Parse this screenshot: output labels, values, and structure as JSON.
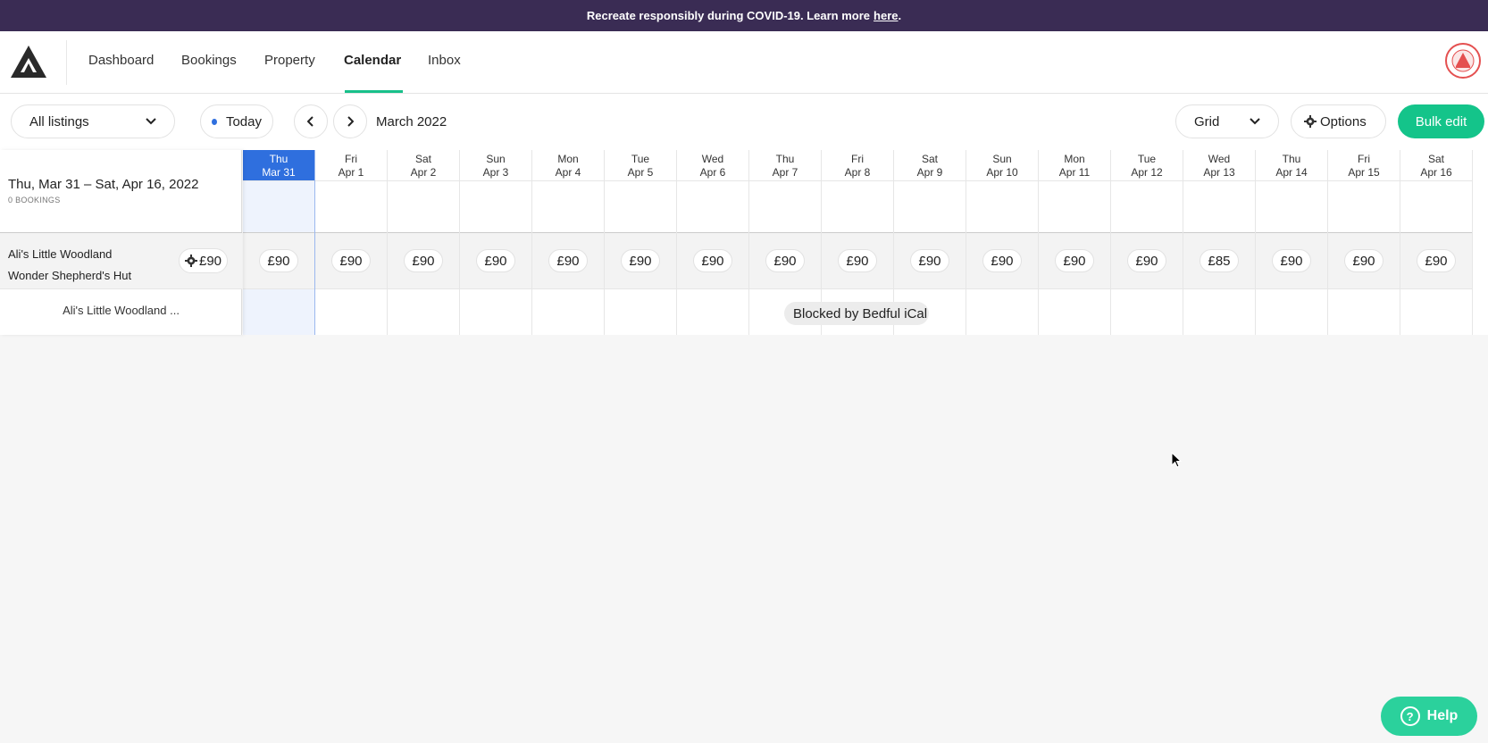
{
  "banner": {
    "text": "Recreate responsibly during COVID-19. Learn more",
    "link": "here",
    "suffix": "."
  },
  "nav": {
    "items": [
      {
        "label": "Dashboard"
      },
      {
        "label": "Bookings"
      },
      {
        "label": "Property"
      },
      {
        "label": "Calendar"
      },
      {
        "label": "Inbox"
      }
    ],
    "active": "Calendar"
  },
  "toolbar": {
    "listings_select": "All listings",
    "today_label": "Today",
    "month_label": "March 2022",
    "view_select": "Grid",
    "options_label": "Options",
    "bulk_edit_label": "Bulk edit"
  },
  "calendar": {
    "range_title": "Thu, Mar 31 – Sat, Apr 16, 2022",
    "bookings_count": "0 BOOKINGS",
    "listing_name_line1": "Ali's Little Woodland",
    "listing_name_line2": "Wonder Shepherd's Hut",
    "listing_base_price": "£90",
    "listing_short_name": "Ali's Little Woodland ...",
    "blocked_label": "Blocked by Bedful iCal",
    "days": [
      {
        "weekday": "Thu",
        "date": "Mar 31",
        "price": "£90",
        "today": true
      },
      {
        "weekday": "Fri",
        "date": "Apr 1",
        "price": "£90"
      },
      {
        "weekday": "Sat",
        "date": "Apr 2",
        "price": "£90"
      },
      {
        "weekday": "Sun",
        "date": "Apr 3",
        "price": "£90"
      },
      {
        "weekday": "Mon",
        "date": "Apr 4",
        "price": "£90"
      },
      {
        "weekday": "Tue",
        "date": "Apr 5",
        "price": "£90"
      },
      {
        "weekday": "Wed",
        "date": "Apr 6",
        "price": "£90"
      },
      {
        "weekday": "Thu",
        "date": "Apr 7",
        "price": "£90"
      },
      {
        "weekday": "Fri",
        "date": "Apr 8",
        "price": "£90"
      },
      {
        "weekday": "Sat",
        "date": "Apr 9",
        "price": "£90"
      },
      {
        "weekday": "Sun",
        "date": "Apr 10",
        "price": "£90"
      },
      {
        "weekday": "Mon",
        "date": "Apr 11",
        "price": "£90"
      },
      {
        "weekday": "Tue",
        "date": "Apr 12",
        "price": "£90"
      },
      {
        "weekday": "Wed",
        "date": "Apr 13",
        "price": "£85"
      },
      {
        "weekday": "Thu",
        "date": "Apr 14",
        "price": "£90"
      },
      {
        "weekday": "Fri",
        "date": "Apr 15",
        "price": "£90"
      },
      {
        "weekday": "Sat",
        "date": "Apr 16",
        "price": "£90"
      }
    ]
  },
  "help": {
    "label": "Help"
  },
  "colors": {
    "banner": "#3a2c54",
    "accent": "#14c48a",
    "today": "#2f6fde"
  }
}
